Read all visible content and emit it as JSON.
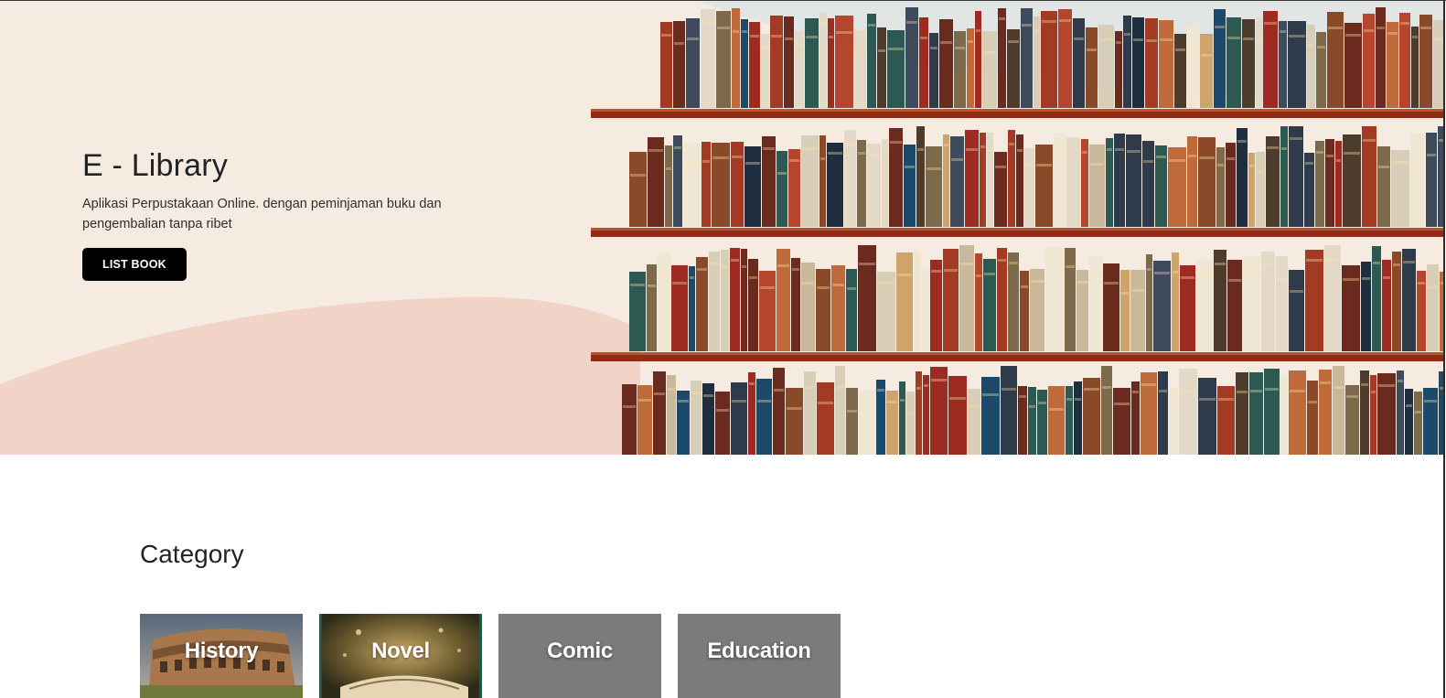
{
  "hero": {
    "title": "E - Library",
    "description": "Aplikasi Perpustakaan Online. dengan peminjaman buku dan pengembalian tanpa ribet",
    "button_label": "LIST BOOK",
    "background_color": "#f6ebe0",
    "wave_color": "#f1d3c8",
    "button_color": "#000000"
  },
  "category": {
    "title": "Category",
    "items": [
      {
        "label": "History",
        "image": "colosseum-photo"
      },
      {
        "label": "Novel",
        "image": "open-book-fantasy-photo"
      },
      {
        "label": "Comic",
        "image": "none"
      },
      {
        "label": "Education",
        "image": "none"
      }
    ],
    "placeholder_color": "#7b7b7b"
  }
}
